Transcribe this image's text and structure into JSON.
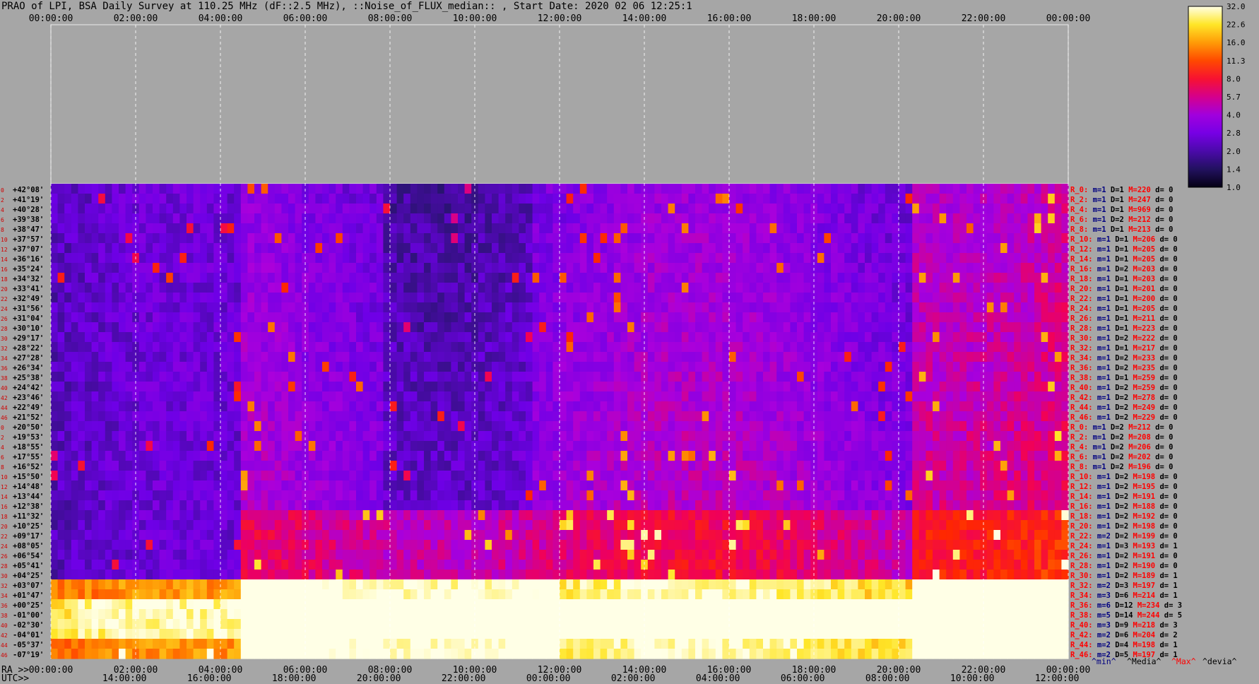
{
  "title": "PRAO of LPI, BSA Daily Survey at 110.25 MHz (dF::2.5 MHz), ::Noise_of_FLUX_median:: , Start Date: 2020 02 06 12:25:1",
  "chart_data": {
    "type": "heatmap",
    "title": "PRAO of LPI, BSA Daily Survey at 110.25 MHz (dF::2.5 MHz), ::Noise_of_FLUX_median:: , Start Date: 2020 02 06 12:25:1",
    "x_top_ticks": [
      "00:00:00",
      "02:00:00",
      "04:00:00",
      "06:00:00",
      "08:00:00",
      "10:00:00",
      "12:00:00",
      "14:00:00",
      "16:00:00",
      "18:00:00",
      "20:00:00",
      "22:00:00",
      "00:00:00"
    ],
    "x_bottom_ra_prefix": "RA >>",
    "x_bottom_ra_ticks": [
      "00:00:00",
      "02:00:00",
      "04:00:00",
      "06:00:00",
      "08:00:00",
      "10:00:00",
      "12:00:00",
      "14:00:00",
      "16:00:00",
      "18:00:00",
      "20:00:00",
      "22:00:00",
      "00:00:00"
    ],
    "x_bottom_utc_prefix": "UTC>>",
    "x_bottom_utc_ticks": [
      "14:00:00",
      "16:00:00",
      "18:00:00",
      "20:00:00",
      "22:00:00",
      "00:00:00",
      "02:00:00",
      "04:00:00",
      "06:00:00",
      "08:00:00",
      "10:00:00",
      "12:00:00"
    ],
    "row_indices": [
      "0",
      "2",
      "4",
      "6",
      "8",
      "10",
      "12",
      "14",
      "16",
      "18",
      "20",
      "22",
      "24",
      "26",
      "28",
      "30",
      "32",
      "34",
      "36",
      "38",
      "40",
      "42",
      "44",
      "46",
      "0",
      "2",
      "4",
      "6",
      "8",
      "10",
      "12",
      "14",
      "16",
      "18",
      "20",
      "22",
      "24",
      "26",
      "28",
      "30",
      "32",
      "34",
      "36",
      "38",
      "40",
      "42",
      "44",
      "46"
    ],
    "declinations": [
      "+42°08'",
      "+41°19'",
      "+40°28'",
      "+39°38'",
      "+38°47'",
      "+37°57'",
      "+37°07'",
      "+36°16'",
      "+35°24'",
      "+34°32'",
      "+33°41'",
      "+32°49'",
      "+31°56'",
      "+31°04'",
      "+30°10'",
      "+29°17'",
      "+28°22'",
      "+27°28'",
      "+26°34'",
      "+25°38'",
      "+24°42'",
      "+23°46'",
      "+22°49'",
      "+21°52'",
      "+20°50'",
      "+19°53'",
      "+18°55'",
      "+17°55'",
      "+16°52'",
      "+15°50'",
      "+14°48'",
      "+13°44'",
      "+12°38'",
      "+11°32'",
      "+10°25'",
      "+09°17'",
      "+08°05'",
      "+06°54'",
      "+05°41'",
      "+04°25'",
      "+03°07'",
      "+01°47'",
      "+00°25'",
      "-01°00'",
      "-02°30'",
      "-04°01'",
      "-05°37'",
      "-07°19'"
    ],
    "row_stats": [
      {
        "r": "R_0:",
        "m": "m=1",
        "d": "D=1",
        "M": "M=220",
        "dev": "d= 0"
      },
      {
        "r": "R_2:",
        "m": "m=1",
        "d": "D=1",
        "M": "M=247",
        "dev": "d= 0"
      },
      {
        "r": "R_4:",
        "m": "m=1",
        "d": "D=1",
        "M": "M=969",
        "dev": "d= 0"
      },
      {
        "r": "R_6:",
        "m": "m=1",
        "d": "D=2",
        "M": "M=212",
        "dev": "d= 0"
      },
      {
        "r": "R_8:",
        "m": "m=1",
        "d": "D=1",
        "M": "M=213",
        "dev": "d= 0"
      },
      {
        "r": "R_10:",
        "m": "m=1",
        "d": "D=1",
        "M": "M=206",
        "dev": "d= 0"
      },
      {
        "r": "R_12:",
        "m": "m=1",
        "d": "D=1",
        "M": "M=205",
        "dev": "d= 0"
      },
      {
        "r": "R_14:",
        "m": "m=1",
        "d": "D=1",
        "M": "M=205",
        "dev": "d= 0"
      },
      {
        "r": "R_16:",
        "m": "m=1",
        "d": "D=2",
        "M": "M=203",
        "dev": "d= 0"
      },
      {
        "r": "R_18:",
        "m": "m=1",
        "d": "D=1",
        "M": "M=203",
        "dev": "d= 0"
      },
      {
        "r": "R_20:",
        "m": "m=1",
        "d": "D=1",
        "M": "M=201",
        "dev": "d= 0"
      },
      {
        "r": "R_22:",
        "m": "m=1",
        "d": "D=1",
        "M": "M=200",
        "dev": "d= 0"
      },
      {
        "r": "R_24:",
        "m": "m=1",
        "d": "D=1",
        "M": "M=205",
        "dev": "d= 0"
      },
      {
        "r": "R_26:",
        "m": "m=1",
        "d": "D=1",
        "M": "M=211",
        "dev": "d= 0"
      },
      {
        "r": "R_28:",
        "m": "m=1",
        "d": "D=1",
        "M": "M=223",
        "dev": "d= 0"
      },
      {
        "r": "R_30:",
        "m": "m=1",
        "d": "D=2",
        "M": "M=222",
        "dev": "d= 0"
      },
      {
        "r": "R_32:",
        "m": "m=1",
        "d": "D=1",
        "M": "M=217",
        "dev": "d= 0"
      },
      {
        "r": "R_34:",
        "m": "m=1",
        "d": "D=2",
        "M": "M=233",
        "dev": "d= 0"
      },
      {
        "r": "R_36:",
        "m": "m=1",
        "d": "D=2",
        "M": "M=235",
        "dev": "d= 0"
      },
      {
        "r": "R_38:",
        "m": "m=1",
        "d": "D=1",
        "M": "M=259",
        "dev": "d= 0"
      },
      {
        "r": "R_40:",
        "m": "m=1",
        "d": "D=2",
        "M": "M=259",
        "dev": "d= 0"
      },
      {
        "r": "R_42:",
        "m": "m=1",
        "d": "D=2",
        "M": "M=278",
        "dev": "d= 0"
      },
      {
        "r": "R_44:",
        "m": "m=1",
        "d": "D=2",
        "M": "M=249",
        "dev": "d= 0"
      },
      {
        "r": "R_46:",
        "m": "m=1",
        "d": "D=2",
        "M": "M=229",
        "dev": "d= 0"
      },
      {
        "r": "R_0:",
        "m": "m=1",
        "d": "D=2",
        "M": "M=212",
        "dev": "d= 0"
      },
      {
        "r": "R_2:",
        "m": "m=1",
        "d": "D=2",
        "M": "M=208",
        "dev": "d= 0"
      },
      {
        "r": "R_4:",
        "m": "m=1",
        "d": "D=2",
        "M": "M=206",
        "dev": "d= 0"
      },
      {
        "r": "R_6:",
        "m": "m=1",
        "d": "D=2",
        "M": "M=202",
        "dev": "d= 0"
      },
      {
        "r": "R_8:",
        "m": "m=1",
        "d": "D=2",
        "M": "M=196",
        "dev": "d= 0"
      },
      {
        "r": "R_10:",
        "m": "m=1",
        "d": "D=2",
        "M": "M=198",
        "dev": "d= 0"
      },
      {
        "r": "R_12:",
        "m": "m=1",
        "d": "D=2",
        "M": "M=195",
        "dev": "d= 0"
      },
      {
        "r": "R_14:",
        "m": "m=1",
        "d": "D=2",
        "M": "M=191",
        "dev": "d= 0"
      },
      {
        "r": "R_16:",
        "m": "m=1",
        "d": "D=2",
        "M": "M=188",
        "dev": "d= 0"
      },
      {
        "r": "R_18:",
        "m": "m=1",
        "d": "D=2",
        "M": "M=192",
        "dev": "d= 0"
      },
      {
        "r": "R_20:",
        "m": "m=1",
        "d": "D=2",
        "M": "M=198",
        "dev": "d= 0"
      },
      {
        "r": "R_22:",
        "m": "m=2",
        "d": "D=2",
        "M": "M=199",
        "dev": "d= 0"
      },
      {
        "r": "R_24:",
        "m": "m=1",
        "d": "D=3",
        "M": "M=193",
        "dev": "d= 1"
      },
      {
        "r": "R_26:",
        "m": "m=1",
        "d": "D=2",
        "M": "M=191",
        "dev": "d= 0"
      },
      {
        "r": "R_28:",
        "m": "m=1",
        "d": "D=2",
        "M": "M=190",
        "dev": "d= 0"
      },
      {
        "r": "R_30:",
        "m": "m=1",
        "d": "D=2",
        "M": "M=189",
        "dev": "d= 1"
      },
      {
        "r": "R_32:",
        "m": "m=2",
        "d": "D=3",
        "M": "M=197",
        "dev": "d= 1"
      },
      {
        "r": "R_34:",
        "m": "m=3",
        "d": "D=6",
        "M": "M=214",
        "dev": "d= 1"
      },
      {
        "r": "R_36:",
        "m": "m=6",
        "d": "D=12",
        "M": "M=234",
        "dev": "d= 3"
      },
      {
        "r": "R_38:",
        "m": "m=5",
        "d": "D=14",
        "M": "M=244",
        "dev": "d= 5"
      },
      {
        "r": "R_40:",
        "m": "m=3",
        "d": "D=9",
        "M": "M=218",
        "dev": "d= 3"
      },
      {
        "r": "R_42:",
        "m": "m=2",
        "d": "D=6",
        "M": "M=204",
        "dev": "d= 2"
      },
      {
        "r": "R_44:",
        "m": "m=2",
        "d": "D=4",
        "M": "M=198",
        "dev": "d= 1"
      },
      {
        "r": "R_46:",
        "m": "m=2",
        "d": "D=5",
        "M": "M=197",
        "dev": "d= 1"
      }
    ],
    "stats_legend": [
      "^min^",
      "^Media^",
      "^Max^",
      "^devia^"
    ],
    "colorbar_ticks": [
      "32.0",
      "22.6",
      "16.0",
      "11.3",
      "8.0",
      "5.7",
      "4.0",
      "2.8",
      "2.0",
      "1.4",
      "1.0"
    ],
    "colorbar_scale": "log",
    "colors": {
      "background": "#a6a6a6",
      "stat_red": "#ff0000",
      "stat_blue": "#000080",
      "grid": "#ffffff"
    }
  }
}
